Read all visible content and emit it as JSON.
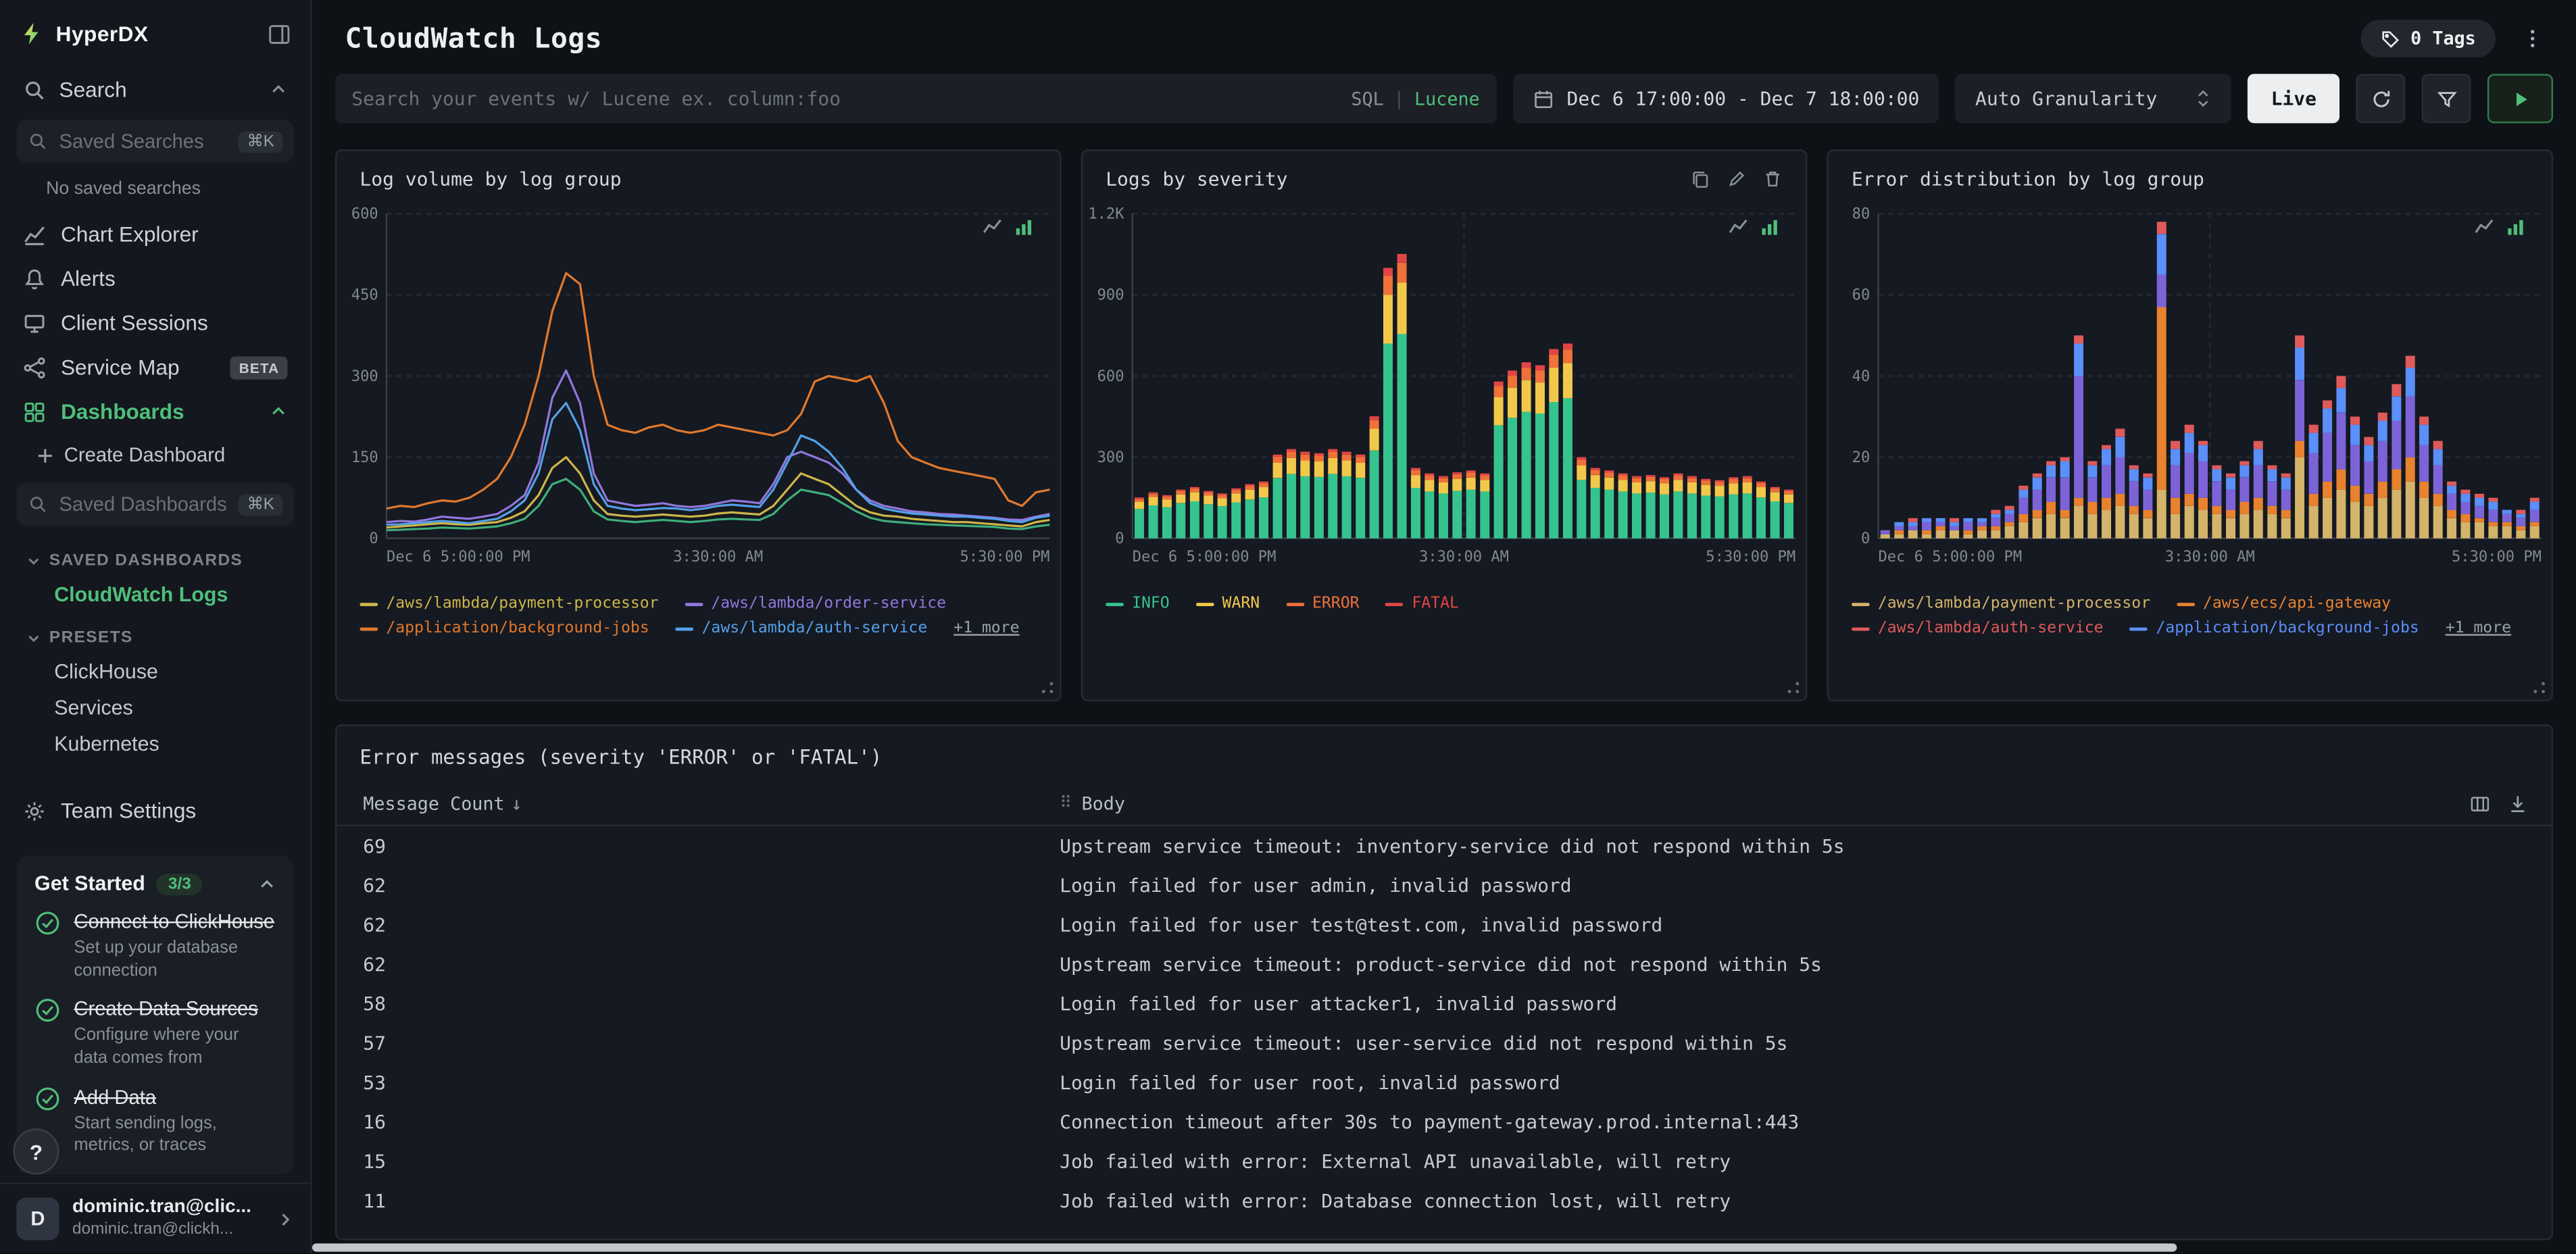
{
  "colors": {
    "accent": "#4fbe7b"
  },
  "sidebar": {
    "brand": "HyperDX",
    "search_section": "Search",
    "saved_searches_placeholder": "Saved Searches",
    "saved_searches_kbd": "⌘K",
    "no_saved": "No saved searches",
    "nav": [
      {
        "label": "Chart Explorer"
      },
      {
        "label": "Alerts"
      },
      {
        "label": "Client Sessions"
      },
      {
        "label": "Service Map",
        "badge": "BETA"
      },
      {
        "label": "Dashboards"
      }
    ],
    "create_dashboard": "Create Dashboard",
    "saved_dashboards_placeholder": "Saved Dashboards",
    "saved_dashboards_kbd": "⌘K",
    "sections": {
      "saved_dashboards_title": "SAVED DASHBOARDS",
      "saved_items": [
        {
          "label": "CloudWatch Logs"
        }
      ],
      "presets_title": "PRESETS",
      "preset_items": [
        {
          "label": "ClickHouse"
        },
        {
          "label": "Services"
        },
        {
          "label": "Kubernetes"
        }
      ]
    },
    "team_settings": "Team Settings",
    "get_started": {
      "title": "Get Started",
      "badge": "3/3",
      "items": [
        {
          "title": "Connect to ClickHouse",
          "subtitle": "Set up your database connection"
        },
        {
          "title": "Create Data Sources",
          "subtitle": "Configure where your data comes from"
        },
        {
          "title": "Add Data",
          "subtitle": "Start sending logs, metrics, or traces"
        }
      ]
    },
    "help": "?",
    "user": {
      "initial": "D",
      "name": "dominic.tran@clic...",
      "email": "dominic.tran@clickh..."
    }
  },
  "header": {
    "title": "CloudWatch Logs",
    "tags": "0 Tags"
  },
  "toolbar": {
    "search_placeholder": "Search your events w/ Lucene ex. column:foo",
    "lang_sql": "SQL",
    "lang_sep": "|",
    "lang_lucene": "Lucene",
    "date_range": "Dec 6 17:00:00 - Dec 7 18:00:00",
    "granularity": "Auto Granularity",
    "live": "Live"
  },
  "table_section": {
    "title": "Error messages (severity 'ERROR' or 'FATAL')",
    "col_count": "Message Count",
    "sort": "↓",
    "col_body": "Body",
    "grip": "⠿",
    "rows": [
      {
        "count": "69",
        "body": "Upstream service timeout: inventory-service did not respond within 5s"
      },
      {
        "count": "62",
        "body": "Login failed for user admin, invalid password"
      },
      {
        "count": "62",
        "body": "Login failed for user test@test.com, invalid password"
      },
      {
        "count": "62",
        "body": "Upstream service timeout: product-service did not respond within 5s"
      },
      {
        "count": "58",
        "body": "Login failed for user attacker1, invalid password"
      },
      {
        "count": "57",
        "body": "Upstream service timeout: user-service did not respond within 5s"
      },
      {
        "count": "53",
        "body": "Login failed for user root, invalid password"
      },
      {
        "count": "16",
        "body": "Connection timeout after 30s to payment-gateway.prod.internal:443"
      },
      {
        "count": "15",
        "body": "Job failed with error: External API unavailable, will retry"
      },
      {
        "count": "11",
        "body": "Job failed with error: Database connection lost, will retry"
      }
    ]
  },
  "chart_data": [
    {
      "type": "line",
      "title": "Log volume by log group",
      "ylim": [
        0,
        600
      ],
      "yticks": [
        {
          "v": 0,
          "label": "0"
        },
        {
          "v": 150,
          "label": "150"
        },
        {
          "v": 300,
          "label": "300"
        },
        {
          "v": 450,
          "label": "450"
        },
        {
          "v": 600,
          "label": "600"
        }
      ],
      "xticks": [
        "Dec 6 5:00:00 PM",
        "3:30:00 AM",
        "5:30:00 PM"
      ],
      "series": [
        {
          "name": "+1 more",
          "color": "#3fae7c",
          "values": [
            15,
            16,
            17,
            18,
            20,
            19,
            18,
            20,
            22,
            28,
            36,
            60,
            100,
            110,
            90,
            50,
            35,
            32,
            30,
            32,
            34,
            32,
            30,
            32,
            35,
            36,
            35,
            34,
            45,
            70,
            90,
            85,
            80,
            65,
            50,
            38,
            32,
            30,
            28,
            26,
            25,
            24,
            23,
            22,
            21,
            18,
            17,
            22,
            25
          ]
        },
        {
          "name": "/aws/lambda/payment-processor",
          "color": "#cdb64a",
          "values": [
            20,
            22,
            24,
            26,
            28,
            26,
            25,
            28,
            30,
            38,
            50,
            80,
            130,
            150,
            120,
            70,
            45,
            42,
            40,
            42,
            44,
            42,
            40,
            42,
            46,
            48,
            46,
            44,
            60,
            90,
            120,
            110,
            100,
            80,
            60,
            48,
            42,
            40,
            36,
            34,
            32,
            30,
            30,
            28,
            26,
            24,
            22,
            30,
            34
          ]
        },
        {
          "name": "/aws/lambda/order-service",
          "color": "#9277dd",
          "values": [
            30,
            32,
            31,
            35,
            40,
            38,
            36,
            40,
            45,
            60,
            80,
            140,
            260,
            310,
            250,
            120,
            70,
            65,
            60,
            62,
            65,
            60,
            58,
            60,
            65,
            70,
            68,
            65,
            100,
            150,
            160,
            150,
            140,
            120,
            90,
            70,
            60,
            55,
            50,
            48,
            45,
            44,
            42,
            40,
            38,
            35,
            34,
            40,
            45
          ]
        },
        {
          "name": "/aws/lambda/auth-service",
          "color": "#54a0e8",
          "values": [
            25,
            26,
            28,
            30,
            32,
            30,
            28,
            32,
            36,
            50,
            70,
            120,
            220,
            250,
            200,
            100,
            60,
            55,
            52,
            54,
            56,
            55,
            52,
            55,
            60,
            62,
            60,
            58,
            90,
            140,
            190,
            180,
            160,
            130,
            90,
            65,
            55,
            50,
            46,
            44,
            42,
            40,
            40,
            38,
            36,
            32,
            30,
            38,
            42
          ]
        },
        {
          "name": "/application/background-jobs",
          "color": "#e0792e",
          "values": [
            55,
            60,
            58,
            65,
            70,
            68,
            75,
            90,
            110,
            150,
            210,
            300,
            420,
            490,
            470,
            300,
            210,
            200,
            195,
            205,
            210,
            200,
            195,
            200,
            210,
            205,
            200,
            195,
            190,
            200,
            230,
            290,
            300,
            295,
            290,
            300,
            250,
            180,
            150,
            140,
            130,
            125,
            120,
            115,
            110,
            70,
            60,
            85,
            90
          ]
        }
      ],
      "legend": [
        {
          "label": "/aws/lambda/payment-processor",
          "color": "#cdb64a"
        },
        {
          "label": "/aws/lambda/order-service",
          "color": "#9277dd"
        },
        {
          "label": "/application/background-jobs",
          "color": "#e0792e"
        },
        {
          "label": "/aws/lambda/auth-service",
          "color": "#54a0e8"
        }
      ],
      "extra": "+1 more"
    },
    {
      "type": "bar",
      "title": "Logs by severity",
      "ylim": [
        0,
        1200
      ],
      "yticks": [
        {
          "v": 0,
          "label": "0"
        },
        {
          "v": 300,
          "label": "300"
        },
        {
          "v": 600,
          "label": "600"
        },
        {
          "v": 900,
          "label": "900"
        },
        {
          "v": 1200,
          "label": "1.2K"
        }
      ],
      "xticks": [
        "Dec 6 5:00:00 PM",
        "3:30:00 AM",
        "5:30:00 PM"
      ],
      "series": [
        {
          "name": "INFO",
          "color": "#35c48e",
          "values": [
            108,
            122,
            115,
            130,
            137,
            126,
            119,
            133,
            144,
            151,
            223,
            238,
            230,
            227,
            238,
            230,
            223,
            324,
            720,
            756,
            187,
            173,
            166,
            176,
            180,
            173,
            418,
            446,
            468,
            461,
            504,
            518,
            216,
            187,
            180,
            173,
            166,
            169,
            162,
            173,
            166,
            158,
            155,
            162,
            166,
            151,
            137,
            130
          ]
        },
        {
          "name": "WARN",
          "color": "#f2c84b",
          "values": [
            27,
            31,
            29,
            32,
            34,
            32,
            30,
            33,
            36,
            38,
            56,
            59,
            58,
            57,
            59,
            58,
            56,
            81,
            180,
            189,
            47,
            43,
            41,
            44,
            45,
            43,
            104,
            112,
            117,
            115,
            126,
            130,
            54,
            47,
            45,
            43,
            41,
            42,
            41,
            43,
            41,
            40,
            39,
            41,
            41,
            38,
            34,
            32
          ]
        },
        {
          "name": "ERROR",
          "color": "#f0713a",
          "values": [
            11,
            12,
            11,
            13,
            13,
            12,
            12,
            13,
            14,
            15,
            22,
            23,
            22,
            22,
            23,
            22,
            22,
            32,
            70,
            74,
            18,
            17,
            16,
            17,
            18,
            17,
            41,
            43,
            46,
            45,
            49,
            50,
            21,
            18,
            18,
            17,
            16,
            16,
            16,
            17,
            16,
            15,
            15,
            16,
            16,
            15,
            13,
            13
          ]
        },
        {
          "name": "FATAL",
          "color": "#e24545",
          "values": [
            5,
            5,
            5,
            5,
            6,
            5,
            5,
            6,
            6,
            6,
            9,
            10,
            10,
            9,
            10,
            10,
            9,
            14,
            30,
            32,
            8,
            7,
            7,
            7,
            8,
            7,
            17,
            19,
            20,
            19,
            21,
            22,
            9,
            8,
            8,
            7,
            7,
            7,
            7,
            7,
            7,
            7,
            6,
            7,
            7,
            6,
            6,
            5
          ]
        }
      ],
      "legend": [
        {
          "label": "INFO",
          "color": "#35c48e"
        },
        {
          "label": "WARN",
          "color": "#f2c84b"
        },
        {
          "label": "ERROR",
          "color": "#f0713a"
        },
        {
          "label": "FATAL",
          "color": "#e24545"
        }
      ],
      "extra": null
    },
    {
      "type": "bar",
      "title": "Error distribution by log group",
      "ylim": [
        0,
        80
      ],
      "yticks": [
        {
          "v": 0,
          "label": "0"
        },
        {
          "v": 20,
          "label": "20"
        },
        {
          "v": 40,
          "label": "40"
        },
        {
          "v": 60,
          "label": "60"
        },
        {
          "v": 80,
          "label": "80"
        }
      ],
      "xticks": [
        "Dec 6 5:00:00 PM",
        "3:30:00 AM",
        "5:30:00 PM"
      ],
      "series": [
        {
          "name": "/aws/lambda/payment-processor",
          "color": "#d4b36a",
          "values": [
            1,
            1,
            2,
            1,
            2,
            2,
            1,
            2,
            2,
            3,
            4,
            5,
            6,
            5,
            8,
            6,
            7,
            8,
            6,
            5,
            12,
            6,
            8,
            7,
            6,
            5,
            6,
            7,
            6,
            5,
            20,
            8,
            10,
            12,
            9,
            8,
            10,
            12,
            14,
            10,
            8,
            5,
            4,
            4,
            3,
            3,
            2,
            3
          ]
        },
        {
          "name": "/aws/ecs/api-gateway",
          "color": "#e8822e",
          "values": [
            0,
            1,
            0,
            1,
            1,
            0,
            1,
            1,
            1,
            1,
            2,
            2,
            3,
            2,
            2,
            3,
            3,
            3,
            2,
            2,
            45,
            4,
            3,
            3,
            2,
            2,
            3,
            3,
            2,
            2,
            4,
            3,
            4,
            5,
            4,
            3,
            4,
            5,
            6,
            4,
            3,
            2,
            2,
            1,
            1,
            1,
            1,
            1
          ]
        },
        {
          "name": "+1 more",
          "color": "#7c63d8",
          "values": [
            1,
            1,
            1,
            2,
            1,
            1,
            2,
            1,
            2,
            2,
            4,
            5,
            6,
            8,
            30,
            6,
            8,
            9,
            6,
            5,
            8,
            8,
            10,
            9,
            6,
            5,
            6,
            8,
            6,
            5,
            15,
            10,
            12,
            14,
            10,
            8,
            10,
            12,
            15,
            9,
            7,
            4,
            3,
            3,
            3,
            2,
            2,
            3
          ]
        },
        {
          "name": "/application/background-jobs",
          "color": "#5b8ff9",
          "values": [
            0,
            1,
            1,
            1,
            1,
            1,
            1,
            1,
            1,
            1,
            2,
            3,
            3,
            4,
            8,
            3,
            4,
            5,
            3,
            3,
            10,
            4,
            5,
            4,
            3,
            3,
            3,
            4,
            3,
            3,
            8,
            5,
            6,
            6,
            5,
            4,
            5,
            6,
            7,
            5,
            4,
            2,
            2,
            2,
            2,
            1,
            1,
            2
          ]
        },
        {
          "name": "/aws/lambda/auth-service",
          "color": "#e05a5a",
          "values": [
            0,
            0,
            1,
            0,
            0,
            1,
            0,
            0,
            1,
            1,
            1,
            1,
            1,
            1,
            2,
            1,
            1,
            2,
            1,
            1,
            3,
            2,
            2,
            1,
            1,
            1,
            1,
            2,
            1,
            1,
            3,
            2,
            2,
            3,
            2,
            2,
            2,
            3,
            3,
            2,
            2,
            1,
            1,
            1,
            1,
            0,
            1,
            1
          ]
        }
      ],
      "legend": [
        {
          "label": "/aws/lambda/payment-processor",
          "color": "#d4b36a"
        },
        {
          "label": "/aws/ecs/api-gateway",
          "color": "#e8822e"
        },
        {
          "label": "/aws/lambda/auth-service",
          "color": "#e05a5a"
        },
        {
          "label": "/application/background-jobs",
          "color": "#5b8ff9"
        }
      ],
      "extra": "+1 more"
    }
  ]
}
